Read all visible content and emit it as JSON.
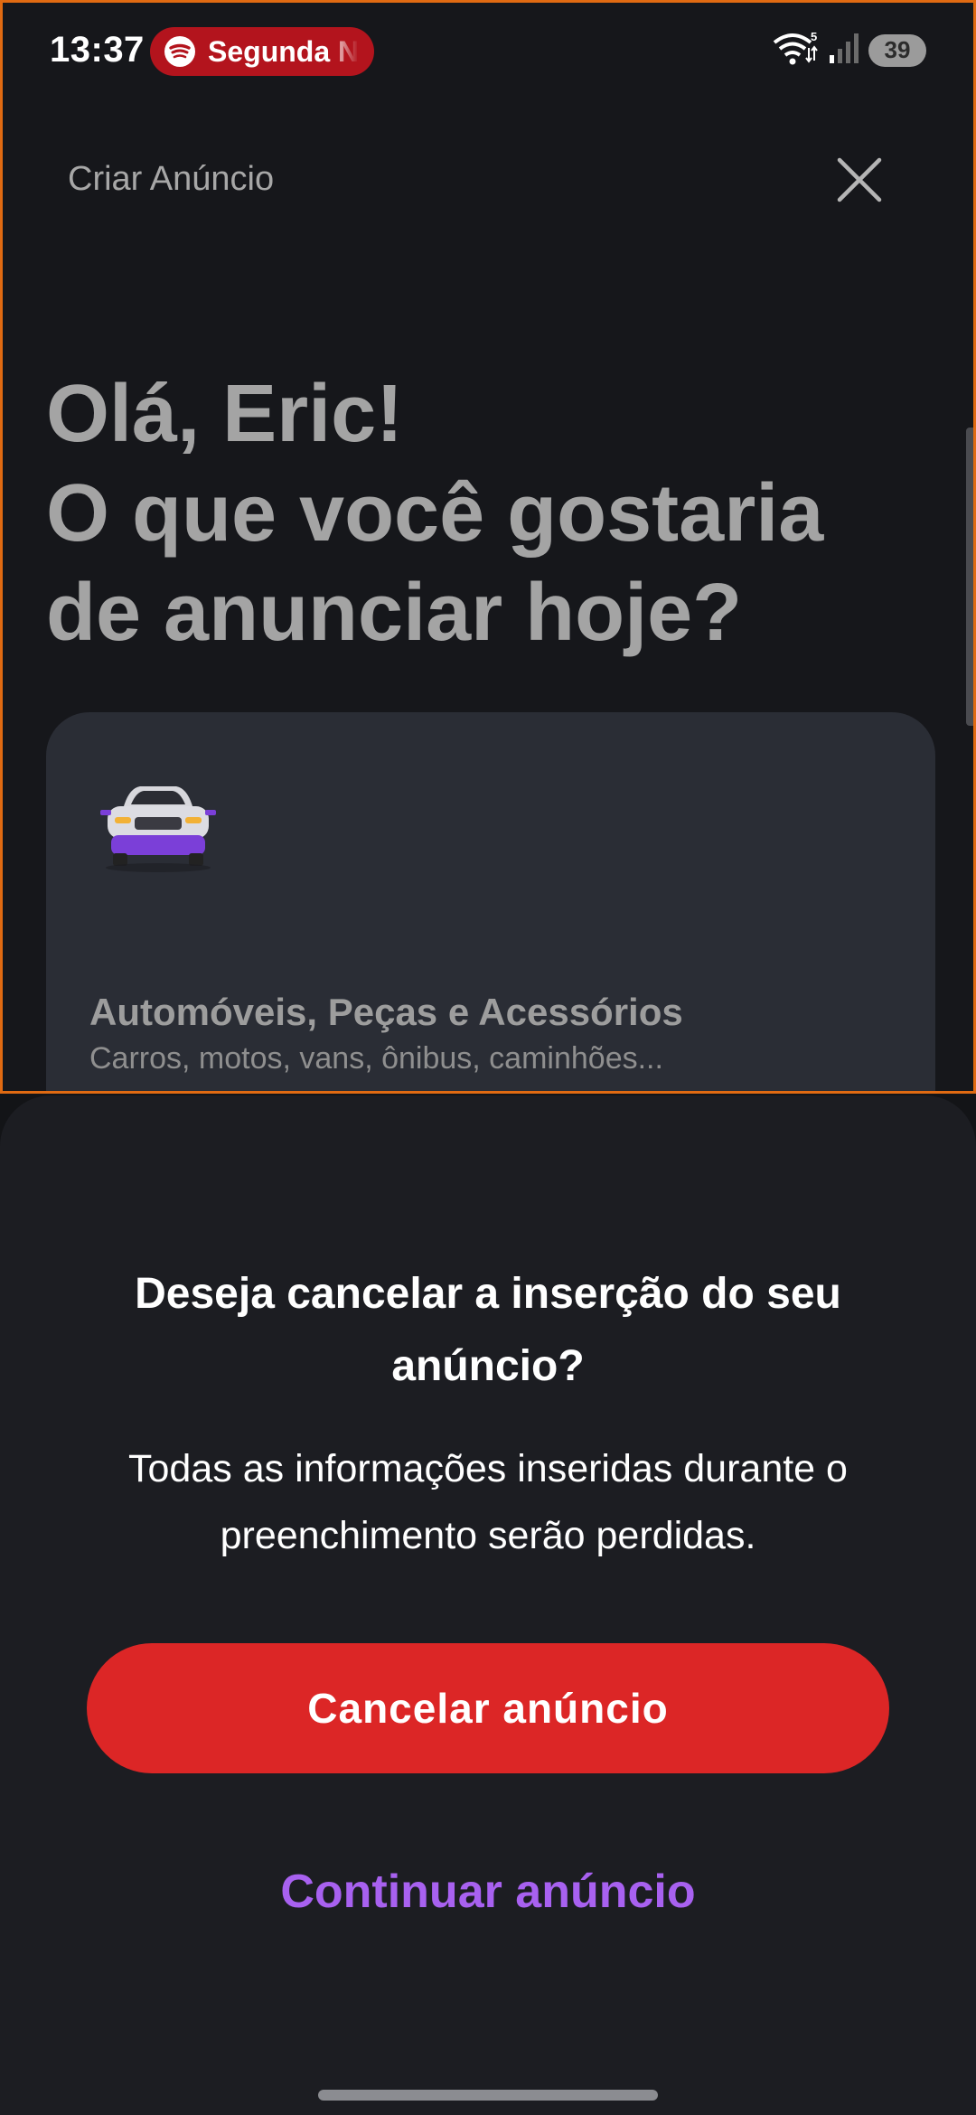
{
  "status_bar": {
    "time": "13:37",
    "media_text": "Segunda N",
    "battery": "39",
    "network_label": "5"
  },
  "background": {
    "header_title": "Criar Anúncio",
    "greeting_line1": "Olá, Eric!",
    "greeting_line2": "O que você gostaria",
    "greeting_line3": "de anunciar hoje?",
    "category": {
      "title": "Automóveis, Peças e Acessórios",
      "subtitle": "Carros, motos, vans, ônibus, caminhões..."
    }
  },
  "dialog": {
    "title": "Deseja cancelar a inserção do seu anúncio?",
    "description": "Todas as informações inseridas durante o preenchimento serão perdidas.",
    "primary_label": "Cancelar anúncio",
    "secondary_label": "Continuar anúncio"
  },
  "colors": {
    "primary_button": "#dc2626",
    "secondary_text": "#a861f0",
    "media_pill": "#b3141d",
    "highlight_border": "#e06a12"
  }
}
